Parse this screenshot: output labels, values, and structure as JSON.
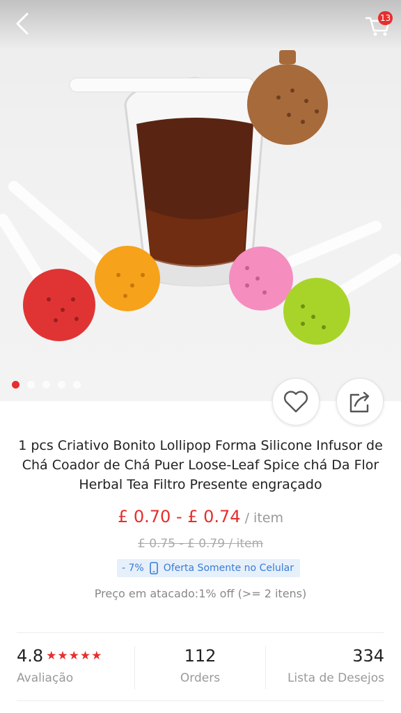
{
  "header": {
    "back_icon": "chevron-left-icon",
    "cart_icon": "cart-icon",
    "cart_count": "13"
  },
  "gallery": {
    "image_count": 5,
    "active_index": 0
  },
  "actions": {
    "wishlist_icon": "heart-icon",
    "share_icon": "share-icon"
  },
  "product": {
    "title": "1 pcs Criativo Bonito Lollipop Forma Silicone Infusor de Chá Coador de Chá Puer Loose-Leaf Spice chá Da Flor Herbal Tea Filtro Presente engraçado",
    "price_range": "£ 0.70 -  £ 0.74",
    "price_unit": " / item",
    "old_price": "£ 0.75 - £ 0.79  / item",
    "discount": "- 7%",
    "mobile_offer": "Oferta Somente no Celular",
    "wholesale": "Preço em atacado:1% off (>= 2 itens)"
  },
  "stats": {
    "rating": "4.8",
    "stars": "★★★★★",
    "rating_label": "Avaliação",
    "orders": "112",
    "orders_label": "Orders",
    "wishlist": "334",
    "wishlist_label": "Lista de Desejos"
  },
  "colors": {
    "accent": "#e62e2e",
    "link": "#3a7bd5",
    "muted": "#999999"
  }
}
